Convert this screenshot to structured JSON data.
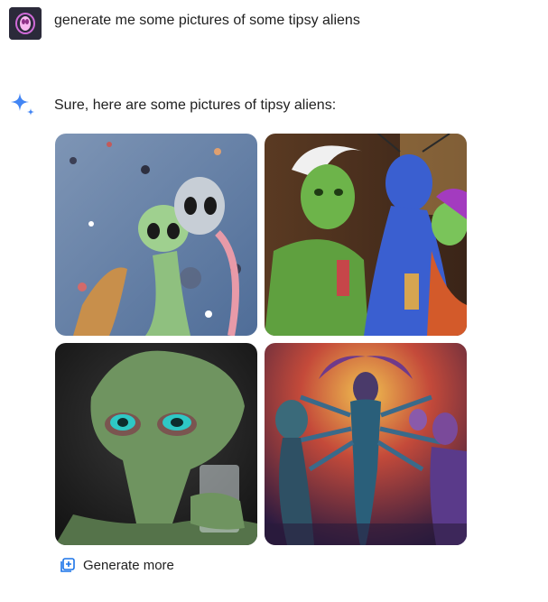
{
  "user_message": {
    "text": "generate me some pictures of some tipsy aliens"
  },
  "assistant": {
    "reply_text": "Sure, here are some pictures of tipsy aliens:",
    "images": [
      {
        "icon": "image-tipsy-aliens-painting"
      },
      {
        "icon": "image-green-blue-aliens-party"
      },
      {
        "icon": "image-green-alien-glass"
      },
      {
        "icon": "image-aliens-dancing-neon"
      }
    ],
    "generate_more_label": "Generate more"
  },
  "colors": {
    "spark_blue": "#4285f4",
    "icon_blue": "#1a73e8",
    "avatar_bg": "#2b2a3a"
  }
}
